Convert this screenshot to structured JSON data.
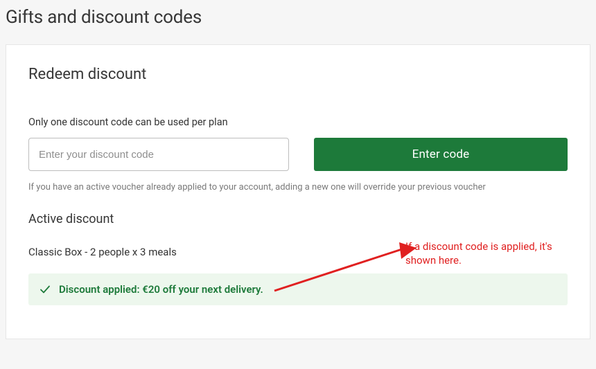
{
  "page": {
    "title": "Gifts and discount codes"
  },
  "redeem": {
    "section_title": "Redeem discount",
    "hint": "Only one discount code can be used per plan",
    "input_placeholder": "Enter your discount code",
    "button_label": "Enter code",
    "override_note": "If you have an active voucher already applied to your account, adding a new one will override your previous voucher"
  },
  "active": {
    "section_title": "Active discount",
    "plan_line": "Classic Box - 2 people x 3 meals",
    "discount_text": "Discount applied: €20 off your next delivery."
  },
  "colors": {
    "accent_green": "#1d7a3a",
    "banner_bg": "#edf7ed",
    "annotation_red": "#e02020"
  },
  "annotation": {
    "text": "If a discount code is applied, it's shown here."
  }
}
